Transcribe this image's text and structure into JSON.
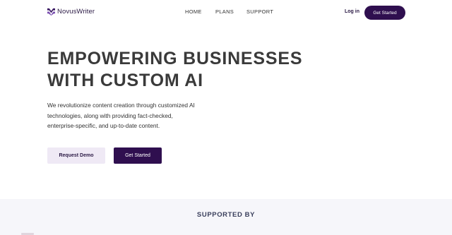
{
  "nav": {
    "brand": "NovusWriter",
    "links": [
      "HOME",
      "PLANS",
      "SUPPORT"
    ],
    "login_label": "Log in",
    "cta_label": "Get Started"
  },
  "hero": {
    "title_lines": [
      "EMPOWERING BUSINESSES",
      "WITH CUSTOM AI"
    ],
    "description_lines": [
      "We revolutionize content creation through customized AI",
      "technologies, along with providing fact-checked,",
      "enterprise-specific, and up-to-date content."
    ],
    "primary_button": "Request Demo",
    "secondary_button": "Get Started"
  },
  "supported": {
    "title": "SUPPORTED BY"
  },
  "colors": {
    "brand_dark": "#2f0f4f",
    "button_light": "#efe9f5",
    "section_bg": "#f6f6fa"
  },
  "icons": {
    "brand_logo": "novuswriter-logo-icon"
  }
}
